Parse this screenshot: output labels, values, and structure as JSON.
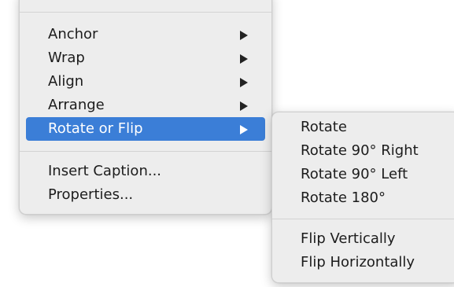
{
  "main_menu": {
    "items": [
      {
        "label": "Anchor",
        "has_submenu": true
      },
      {
        "label": "Wrap",
        "has_submenu": true
      },
      {
        "label": "Align",
        "has_submenu": true
      },
      {
        "label": "Arrange",
        "has_submenu": true
      },
      {
        "label": "Rotate or Flip",
        "has_submenu": true,
        "highlighted": true
      },
      {
        "label": "Insert Caption...",
        "has_submenu": false
      },
      {
        "label": "Properties...",
        "has_submenu": false
      }
    ]
  },
  "submenu": {
    "items": [
      {
        "label": "Rotate"
      },
      {
        "label": "Rotate 90° Right"
      },
      {
        "label": "Rotate 90° Left"
      },
      {
        "label": "Rotate 180°"
      },
      {
        "label": "Flip Vertically"
      },
      {
        "label": "Flip Horizontally"
      }
    ]
  },
  "colors": {
    "highlight": "#3b7ed7",
    "menu_background": "#ededed",
    "text": "#1c1c1c"
  }
}
